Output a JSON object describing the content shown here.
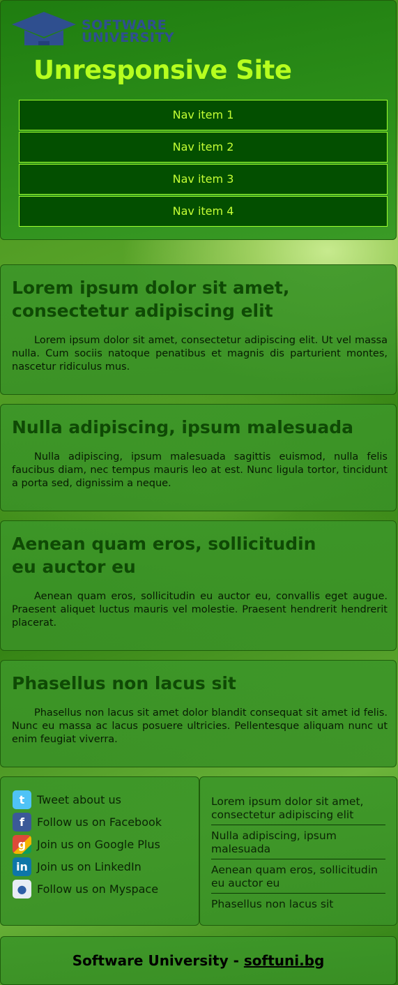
{
  "header": {
    "logo_line1": "SOFTWARE",
    "logo_line2": "UNIVERSITY",
    "site_title": "Unresponsive Site",
    "nav_items": [
      "Nav item 1",
      "Nav item 2",
      "Nav item 3",
      "Nav item 4"
    ]
  },
  "articles": [
    {
      "title": "Lorem ipsum dolor sit amet, consectetur adipiscing elit",
      "body": "Lorem ipsum dolor sit amet, consectetur adipiscing elit. Ut vel massa nulla. Cum sociis natoque penatibus et magnis dis parturient montes, nascetur ridiculus mus."
    },
    {
      "title": "Nulla adipiscing, ipsum malesuada",
      "body": "Nulla adipiscing, ipsum malesuada sagittis euismod, nulla felis faucibus diam, nec tempus mauris leo at est. Nunc ligula tortor, tincidunt a porta sed, dignissim a neque."
    },
    {
      "title": "Aenean quam eros, sollicitudin eu auctor eu",
      "body": "Aenean quam eros, sollicitudin eu auctor eu, convallis eget augue. Praesent aliquet luctus mauris vel molestie. Praesent hendrerit hendrerit placerat."
    },
    {
      "title": "Phasellus non lacus sit",
      "body": "Phasellus non lacus sit amet dolor blandit consequat sit amet id felis. Nunc eu massa ac lacus posuere ultricies. Pellentesque aliquam nunc ut enim feugiat viverra."
    }
  ],
  "social": [
    {
      "label": "Tweet about us",
      "icon": "twitter-icon",
      "color": "#4fc3f7"
    },
    {
      "label": "Follow us on Facebook",
      "icon": "facebook-icon",
      "color": "#3b5998"
    },
    {
      "label": "Join us on Google Plus",
      "icon": "google-plus-icon",
      "color": "#dd4b39"
    },
    {
      "label": "Join us on LinkedIn",
      "icon": "linkedin-icon",
      "color": "#0e76a8"
    },
    {
      "label": "Follow us on Myspace",
      "icon": "myspace-icon",
      "color": "#2e5ea6"
    }
  ],
  "article_links": [
    "Lorem ipsum dolor sit amet, consectetur adipiscing elit",
    "Nulla adipiscing, ipsum malesuada",
    "Aenean quam eros, sollicitudin eu auctor eu",
    "Phasellus non lacus sit"
  ],
  "footer": {
    "text": "Software University - ",
    "link": "softuni.bg"
  }
}
